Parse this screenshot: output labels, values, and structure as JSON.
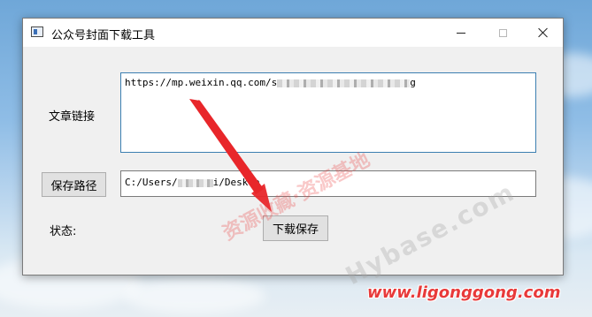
{
  "window": {
    "title": "公众号封面下载工具",
    "minimize_label": "—",
    "maximize_label": "☐",
    "close_label": "✕"
  },
  "form": {
    "article_link_label": "文章链接",
    "article_link_value_prefix": "https://mp.weixin.qq.com/s",
    "article_link_value_suffix": "g",
    "save_path_button": "保存路径",
    "save_path_value_prefix": "C:/Users/",
    "save_path_value_suffix": "i/Deskto",
    "status_label": "状态:",
    "download_save_button": "下载保存"
  },
  "watermarks": {
    "site_url": "www.ligonggong.com",
    "diagonal_cn": "资源收藏·资源基地",
    "diagonal_en": "Hybase.com"
  },
  "colors": {
    "accent_border": "#3c7fb1",
    "arrow": "#e8262a",
    "watermark_red": "#e83a3a"
  }
}
